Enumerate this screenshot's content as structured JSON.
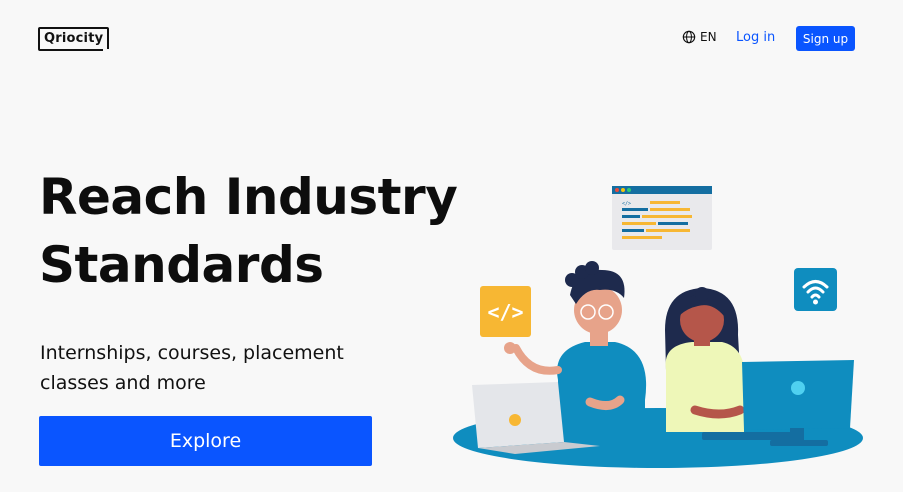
{
  "header": {
    "logo_text": "Qriocity",
    "language": "EN",
    "login_label": "Log in",
    "signup_label": "Sign up"
  },
  "hero": {
    "title_line1": "Reach Industry",
    "title_line2": "Standards",
    "subtitle_line1": "Internships, courses, placement",
    "subtitle_line2": "classes and more",
    "cta_label": "Explore"
  },
  "illustration": {
    "code_badge": "</>",
    "code_window_tag": "</>"
  },
  "colors": {
    "accent": "#0a55ff",
    "teal": "#0f8dbf",
    "yellow": "#f7b733",
    "background": "#f8f8f8"
  }
}
